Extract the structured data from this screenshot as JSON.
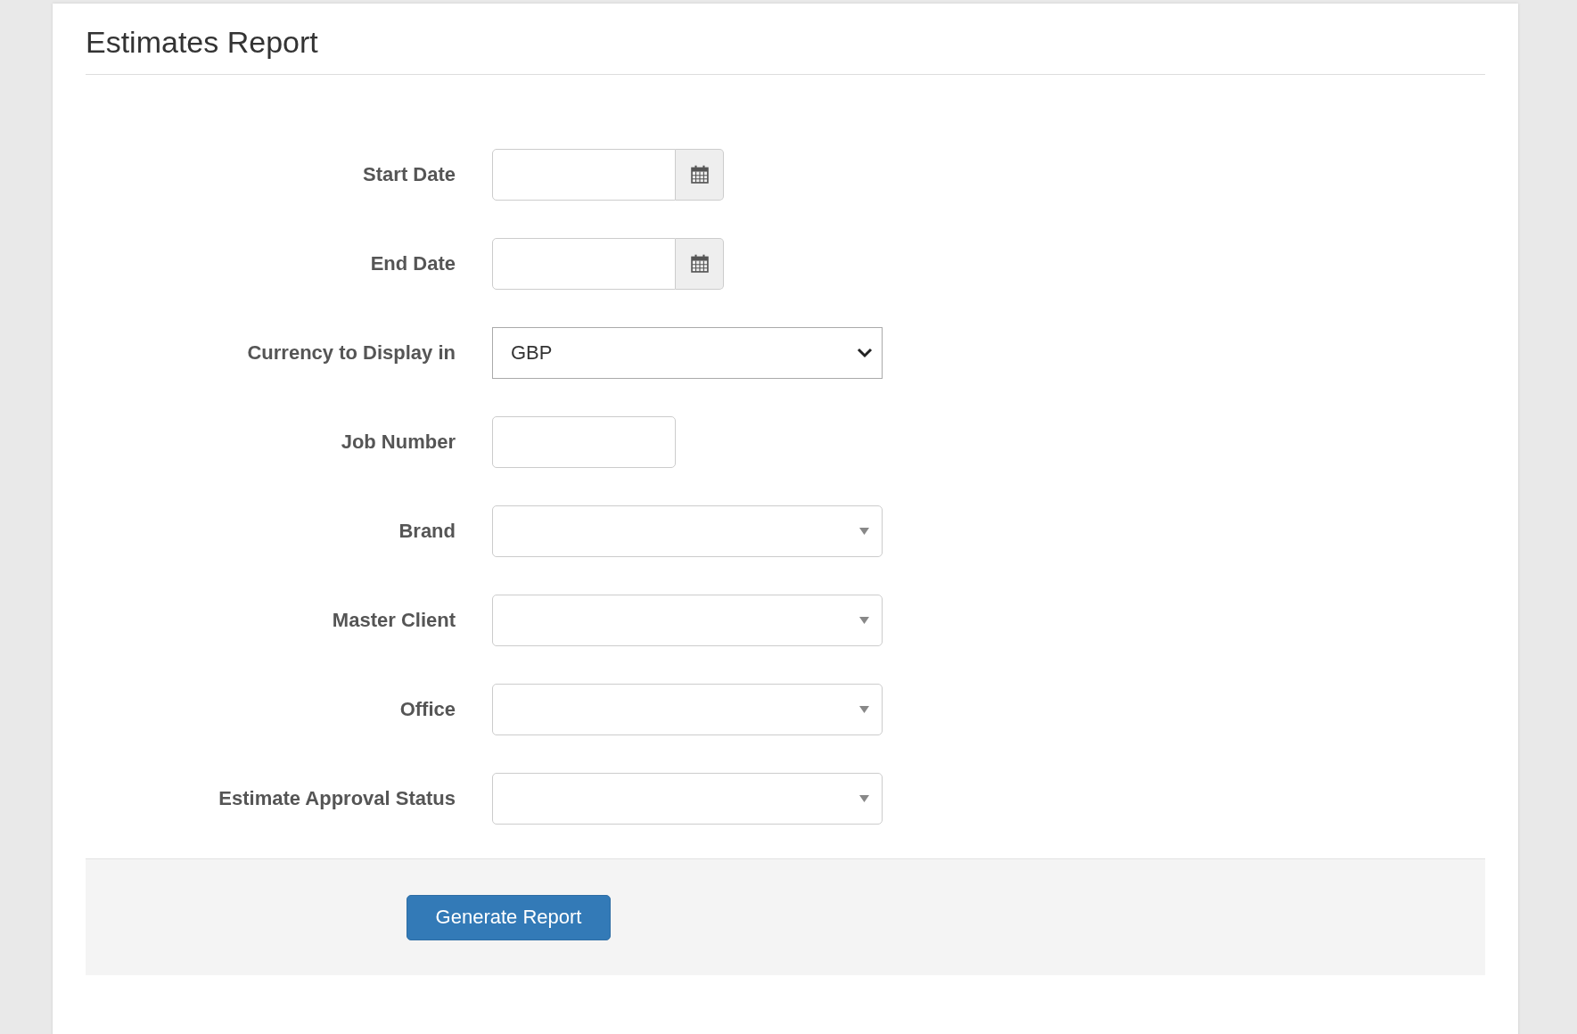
{
  "title": "Estimates Report",
  "fields": [
    {
      "label": "Start Date",
      "kind": "date"
    },
    {
      "label": "End Date",
      "kind": "date"
    },
    {
      "label": "Currency to Display in",
      "kind": "select",
      "value": "GBP"
    },
    {
      "label": "Job Number",
      "kind": "text"
    },
    {
      "label": "Brand",
      "kind": "combo"
    },
    {
      "label": "Master Client",
      "kind": "combo"
    },
    {
      "label": "Office",
      "kind": "combo"
    },
    {
      "label": "Estimate Approval Status",
      "kind": "combo"
    }
  ],
  "button": "Generate Report"
}
